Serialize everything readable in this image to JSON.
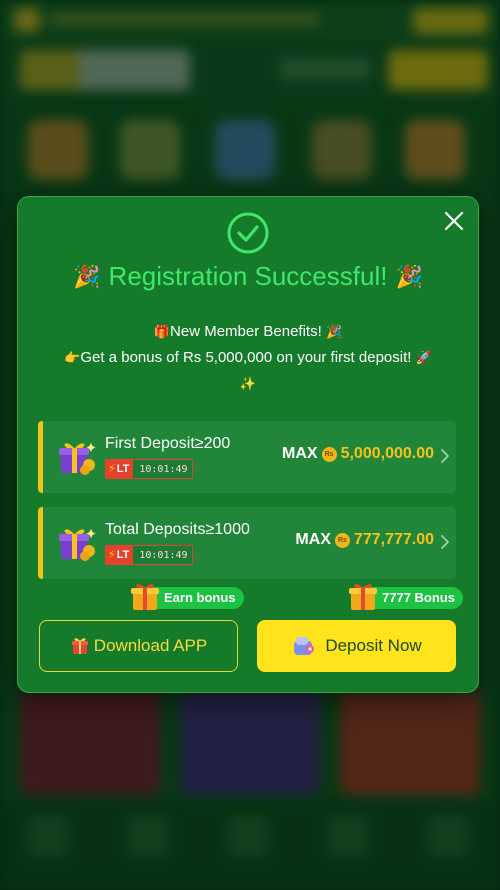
{
  "modal": {
    "title": "Registration Successful!",
    "title_emoji": "🎉",
    "benefits_line1": "New Member Benefits!",
    "benefits_line1_prefix": "🎁",
    "benefits_line1_suffix": "🎉",
    "benefits_line2": "Get a bonus of Rs 5,000,000 on your first deposit!",
    "benefits_line2_prefix": "👉",
    "benefits_line2_suffix": "🚀",
    "benefits_line3": "✨"
  },
  "tiers": [
    {
      "name": "First Deposit≥200",
      "badge": "LT",
      "timer": "10:01:49",
      "max_label": "MAX",
      "currency": "Rs",
      "amount": "5,000,000.00"
    },
    {
      "name": "Total Deposits≥1000",
      "badge": "LT",
      "timer": "10:01:49",
      "max_label": "MAX",
      "currency": "Rs",
      "amount": "777,777.00"
    }
  ],
  "tags": {
    "earn": "Earn bonus",
    "bonus": "7777 Bonus"
  },
  "buttons": {
    "download": "Download APP",
    "deposit": "Deposit Now"
  },
  "colors": {
    "modal_bg": "#157a2a",
    "title": "#3fe86a",
    "accent_yellow": "#ffe41c",
    "amount": "#f4c21c",
    "badge_red": "#e5422e",
    "tag_green": "#1ec243"
  }
}
